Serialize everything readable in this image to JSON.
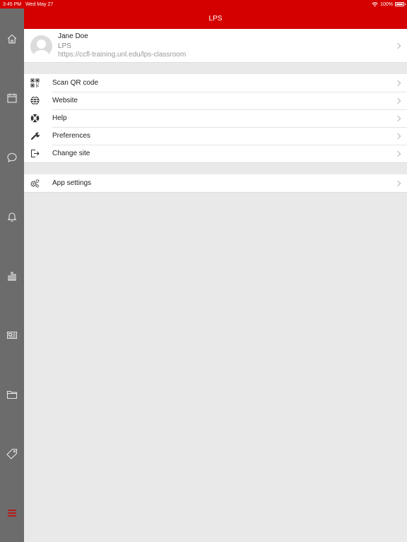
{
  "status_bar": {
    "time": "3:45 PM",
    "date": "Wed May 27",
    "battery": "100%"
  },
  "header": {
    "title": "LPS"
  },
  "sidebar": {
    "items": [
      {
        "icon": "home-icon"
      },
      {
        "icon": "calendar-icon"
      },
      {
        "icon": "chat-icon"
      },
      {
        "icon": "bell-icon"
      },
      {
        "icon": "bar-chart-icon"
      },
      {
        "icon": "news-icon"
      },
      {
        "icon": "folder-icon"
      },
      {
        "icon": "tag-icon"
      },
      {
        "icon": "menu-icon"
      }
    ]
  },
  "profile": {
    "name": "Jane Doe",
    "site": "LPS",
    "url": "https://ccfl-training.unl.edu/lps-classroom"
  },
  "menu": {
    "items": [
      {
        "label": "Scan QR code",
        "icon": "qr-code-icon"
      },
      {
        "label": "Website",
        "icon": "globe-icon"
      },
      {
        "label": "Help",
        "icon": "lifebuoy-icon"
      },
      {
        "label": "Preferences",
        "icon": "wrench-icon"
      },
      {
        "label": "Change site",
        "icon": "sign-out-icon"
      }
    ]
  },
  "settings": {
    "label": "App settings",
    "icon": "cogs-icon"
  },
  "colors": {
    "brand": "#d40000",
    "sidebar": "#6c6c6c",
    "background": "#e9e9e9"
  }
}
